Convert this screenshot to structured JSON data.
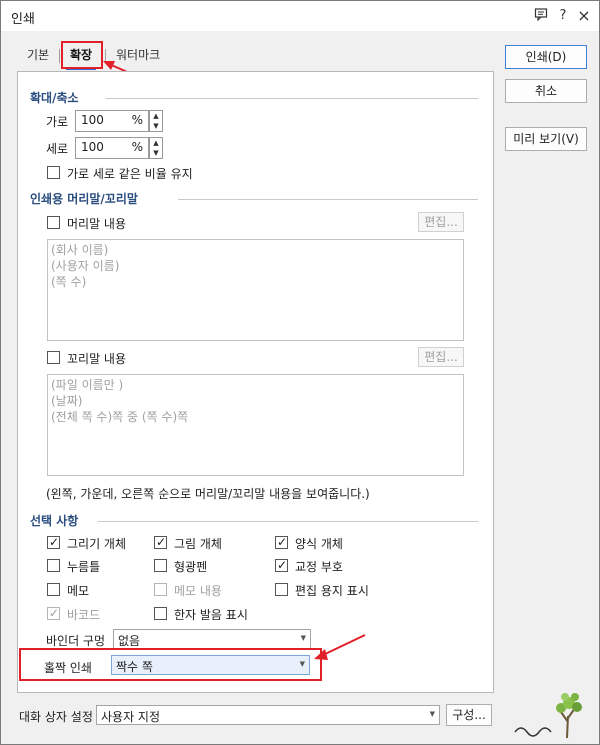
{
  "window": {
    "title": "인쇄",
    "help_icon": "?",
    "close_icon": "×"
  },
  "tabs": [
    {
      "label": "기본",
      "active": false
    },
    {
      "label": "확장",
      "active": true
    },
    {
      "label": "워터마크",
      "active": false
    }
  ],
  "scale": {
    "section_title": "확대/축소",
    "width_label": "가로",
    "width_value": "100",
    "width_unit": "%",
    "height_label": "세로",
    "height_value": "100",
    "height_unit": "%",
    "keep_ratio_label": "가로 세로 같은 비율 유지",
    "keep_ratio_checked": false
  },
  "header_footer": {
    "section_title": "인쇄용 머리말/꼬리말",
    "header_label": "머리말 내용",
    "header_checked": false,
    "header_edit": "편집...",
    "header_lines": [
      "(회사 이름)",
      "(사용자 이름)",
      "(쪽 수)"
    ],
    "footer_label": "꼬리말 내용",
    "footer_checked": false,
    "footer_edit": "편집...",
    "footer_lines": [
      "(파일 이름만 )",
      "(날짜)",
      "(전체 쪽 수)쪽 중 (쪽 수)쪽"
    ],
    "note": "(왼쪽, 가운데, 오른쪽 순으로 머리말/꼬리말 내용을 보여줍니다.)"
  },
  "options": {
    "section_title": "선택 사항",
    "items": [
      {
        "label": "그리기 개체",
        "checked": true,
        "disabled": false
      },
      {
        "label": "그림 개체",
        "checked": true,
        "disabled": false
      },
      {
        "label": "양식 개체",
        "checked": true,
        "disabled": false
      },
      {
        "label": "누름틀",
        "checked": false,
        "disabled": false
      },
      {
        "label": "형광펜",
        "checked": false,
        "disabled": false
      },
      {
        "label": "교정 부호",
        "checked": true,
        "disabled": false
      },
      {
        "label": "메모",
        "checked": false,
        "disabled": false
      },
      {
        "label": "메모 내용",
        "checked": false,
        "disabled": true
      },
      {
        "label": "편집 용지 표시",
        "checked": false,
        "disabled": false
      },
      {
        "label": "바코드",
        "checked": true,
        "disabled": true
      },
      {
        "label": "한자 발음 표시",
        "checked": false,
        "disabled": false
      }
    ],
    "binder_label": "바인더 구멍",
    "binder_value": "없음",
    "odd_even_label": "홀짝 인쇄",
    "odd_even_value": "짝수 쪽"
  },
  "buttons": {
    "print": "인쇄(D)",
    "cancel": "취소",
    "preview": "미리 보기(V)"
  },
  "dialog_settings": {
    "label": "대화 상자 설정",
    "value": "사용자 지정",
    "config_button": "구성..."
  },
  "colors": {
    "highlight": "#e2202a",
    "section_title": "#2a4d7f",
    "accent": "#2b6cd3"
  },
  "icons": {
    "check": "✓",
    "combo_arrow": "▼",
    "spin_up": "▲",
    "spin_down": "▼"
  }
}
